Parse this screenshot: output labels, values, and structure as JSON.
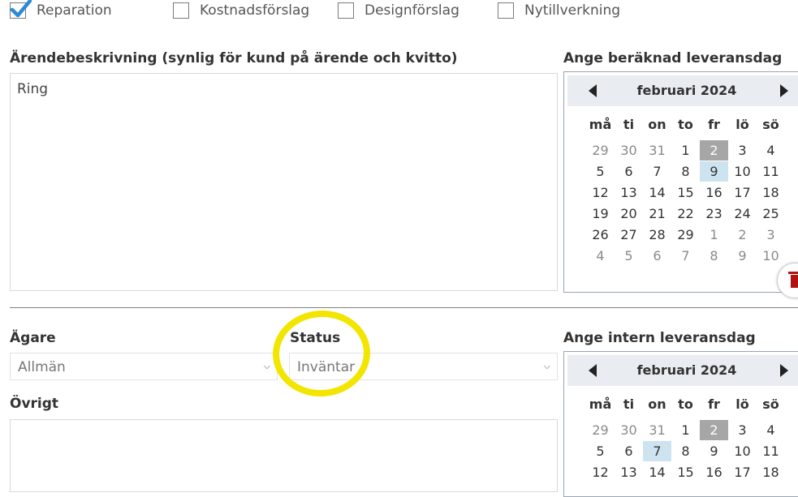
{
  "work_types": [
    {
      "label": "Reparation",
      "checked": true
    },
    {
      "label": "Kostnadsförslag",
      "checked": false
    },
    {
      "label": "Designförslag",
      "checked": false
    },
    {
      "label": "Nytillverkning",
      "checked": false
    }
  ],
  "description": {
    "label": "Ärendebeskrivning (synlig för kund på ärende och kvitto)",
    "value": "Ring"
  },
  "delivery_date": {
    "label": "Ange beräknad leveransdag",
    "month": "februari 2024",
    "weekdays": [
      "må",
      "ti",
      "on",
      "to",
      "fr",
      "lö",
      "sö"
    ],
    "weeks": [
      [
        "29",
        "30",
        "31",
        "1",
        "2",
        "3",
        "4"
      ],
      [
        "5",
        "6",
        "7",
        "8",
        "9",
        "10",
        "11"
      ],
      [
        "12",
        "13",
        "14",
        "15",
        "16",
        "17",
        "18"
      ],
      [
        "19",
        "20",
        "21",
        "22",
        "23",
        "24",
        "25"
      ],
      [
        "26",
        "27",
        "28",
        "29",
        "1",
        "2",
        "3"
      ],
      [
        "4",
        "5",
        "6",
        "7",
        "8",
        "9",
        "10"
      ]
    ],
    "today": "2",
    "selected": "9"
  },
  "owner": {
    "label": "Ägare",
    "value": "Allmän"
  },
  "status": {
    "label": "Status",
    "value": "Inväntar"
  },
  "internal_date": {
    "label": "Ange intern leveransdag",
    "month": "februari 2024",
    "weekdays": [
      "må",
      "ti",
      "on",
      "to",
      "fr",
      "lö",
      "sö"
    ],
    "weeks": [
      [
        "29",
        "30",
        "31",
        "1",
        "2",
        "3",
        "4"
      ],
      [
        "5",
        "6",
        "7",
        "8",
        "9",
        "10",
        "11"
      ],
      [
        "12",
        "13",
        "14",
        "15",
        "16",
        "17",
        "18"
      ]
    ],
    "today": "2",
    "selected": "7"
  },
  "other": {
    "label": "Övrigt",
    "value": ""
  },
  "icons": {
    "check": "checkmark-icon",
    "trash": "trash-icon",
    "prev": "chevron-left-icon",
    "next": "chevron-right-icon",
    "dropdown": "chevron-down-icon"
  },
  "colors": {
    "check": "#2b8bd6",
    "highlight": "#f2e500",
    "today_bg": "#a6a6a6",
    "selected_bg": "#cde4f0",
    "trash": "#b11313"
  }
}
